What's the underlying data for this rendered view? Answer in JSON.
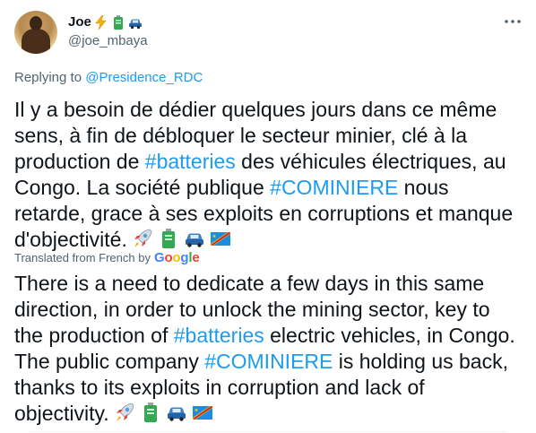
{
  "author": {
    "name": "Joe",
    "handle": "@joe_mbaya",
    "name_emojis": [
      "lightning-icon",
      "battery-icon",
      "car-icon"
    ]
  },
  "reply": {
    "prefix": "Replying to",
    "mention": "@Presidence_RDC"
  },
  "original": {
    "part1": "Il y a besoin de dédier quelques jours dans ce même sens, à fin de débloquer le secteur minier, clé à la production de ",
    "hashtag1": "#batteries",
    "part2": " des véhicules électriques, au Congo. La société publique ",
    "hashtag2": "#COMINIERE",
    "part3": " nous retarde, grace à ses exploits en corruptions et manque d'objectivité."
  },
  "translation": {
    "label": "Translated from French by",
    "provider": "Google",
    "part1": "There is a need to dedicate a few days in this same direction, in order to unlock the mining sector, key to the production of ",
    "hashtag1": "#batteries",
    "part2": " electric vehicles, in Congo. The public company ",
    "hashtag2": "#COMINIERE",
    "part3": " is holding us back, thanks to its exploits in corruption and lack of objectivity."
  },
  "emoji_sequence": [
    "rocket-icon",
    "battery-icon",
    "car-icon",
    "drc-flag-icon"
  ],
  "colors": {
    "link": "#1d9bf0",
    "secondary_text": "#536471",
    "text": "#0f1419"
  }
}
